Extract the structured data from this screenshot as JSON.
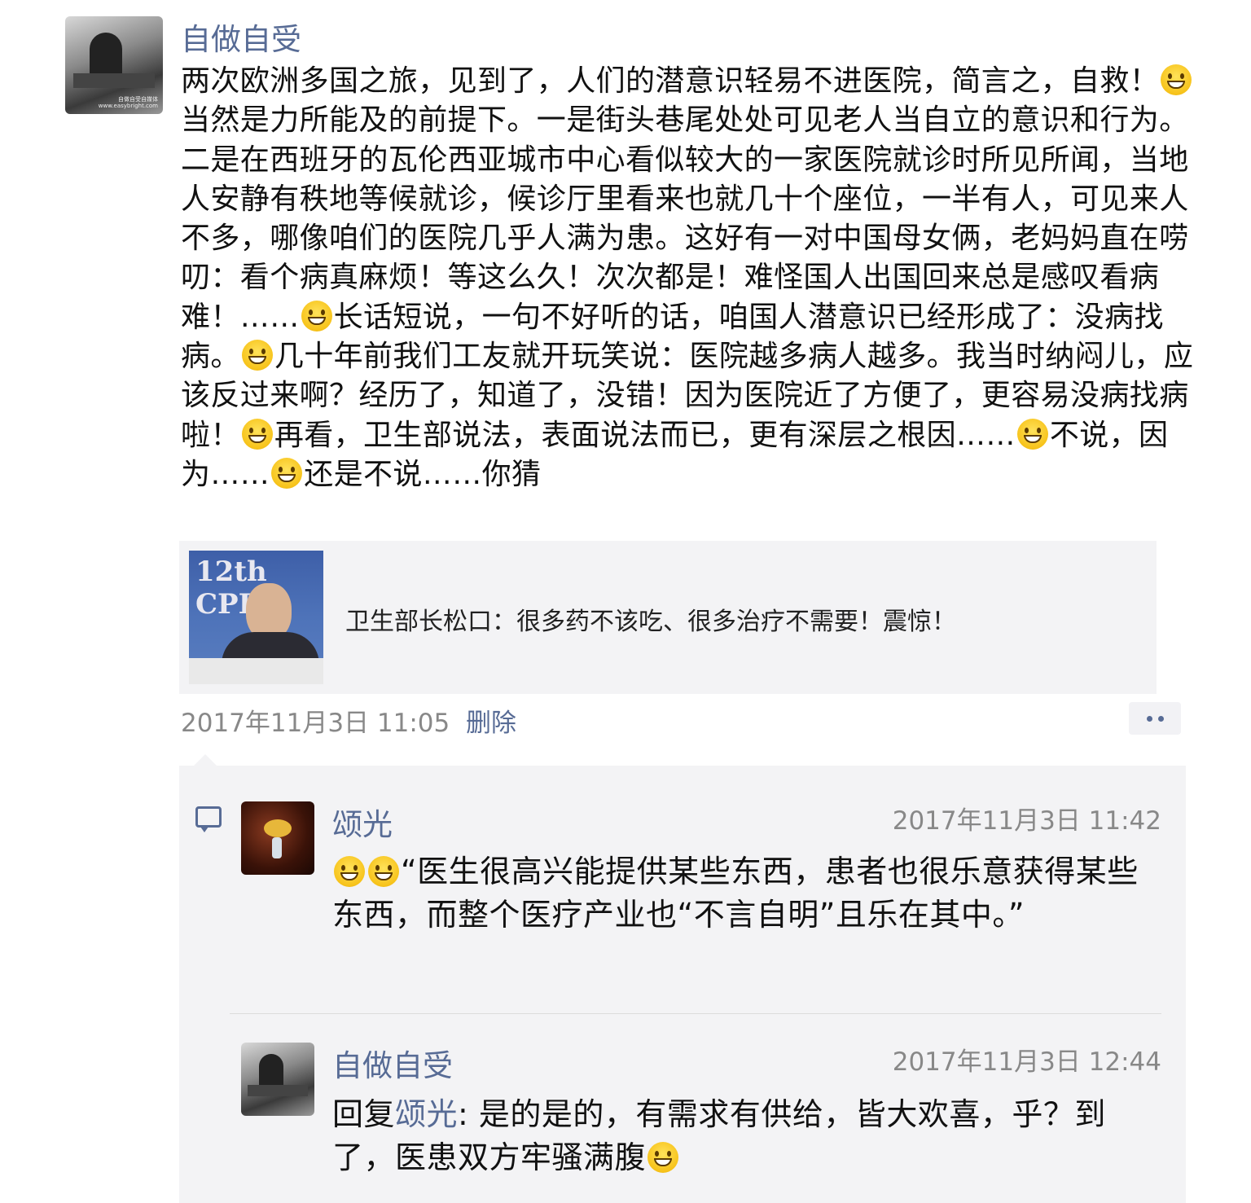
{
  "post": {
    "author": "自做自受",
    "avatar_caption_1": "自做自受自媒体",
    "avatar_caption_2": "www.easybright.com",
    "text_parts": [
      "两次欧洲多国之旅，见到了，人们的潜意识轻易不进医院，简言之，自救！",
      "当然是力所能及的前提下。一是街头巷尾处处可见老人当自立的意识和行为。二是在西班牙的瓦伦西亚城市中心看似较大的一家医院就诊时所见所闻，当地人安静有秩地等候就诊，候诊厅里看来也就几十个座位，一半有人，可见来人不多，哪像咱们的医院几乎人满为患。这好有一对中国母女俩，老妈妈直在唠叨：看个病真麻烦！等这么久！次次都是！难怪国人出国回来总是感叹看病难！……",
      "长话短说，一句不好听的话，咱国人潜意识已经形成了：没病找病。",
      "几十年前我们工友就开玩笑说：医院越多病人越多。我当时纳闷儿，应该反过来啊？经历了，知道了，没错！因为医院近了方便了，更容易没病找病啦！",
      "再看，卫生部说法，表面说法而已，更有深层之根因……",
      "不说，因为……",
      "还是不说……你猜"
    ],
    "link": {
      "thumb_badge": "12th CPP",
      "title": "卫生部长松口：很多药不该吃、很多治疗不需要！震惊！"
    },
    "time": "2017年11月3日 11:05",
    "delete_label": "删除"
  },
  "comments": [
    {
      "author": "颂光",
      "time": "2017年11月3日 11:42",
      "text": "“医生很高兴能提供某些东西，患者也很乐意获得某些东西，而整个医疗产业也“不言自明”且乐在其中。”"
    },
    {
      "author": "自做自受",
      "time": "2017年11月3日 12:44",
      "reply_prefix": "回复",
      "reply_to": "颂光",
      "text_a": ": 是的是的，有需求有供给，皆大欢喜，乎？到了，医患双方牢骚满腹"
    }
  ],
  "icons": {
    "emoji": "grinning-face-icon",
    "emoji_big": "grin-big-eyes-icon",
    "comment": "comment-bubble-icon",
    "more": "more-dots-icon"
  },
  "colors": {
    "link_blue": "#576b95",
    "meta_gray": "#888888",
    "card_bg": "#f3f3f5"
  }
}
